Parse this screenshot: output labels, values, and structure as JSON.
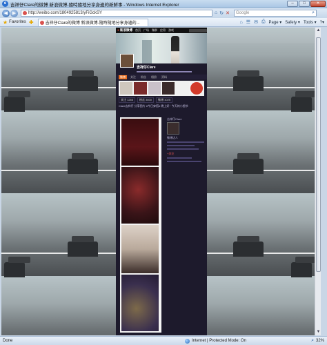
{
  "window": {
    "title": "吉祥仔Clare的微博 新浪微博-隨時隨地分享身邊的新鮮事 - Windows Internet Explorer",
    "min": "–",
    "max": "□",
    "close": "✕"
  },
  "address": {
    "url": "http://weibo.com/1804925813/yFiGckSY",
    "search_placeholder": "Google"
  },
  "commandbar": {
    "favorites_label": "Favorites",
    "tab_title": "吉祥仔Clare的微博 新浪微博-隨時隨地分享身邊的...",
    "page_label": "Page ▾",
    "safety_label": "Safety ▾",
    "tools_label": "Tools ▾",
    "help_label": "?▾"
  },
  "weibo": {
    "logo": "新浪微博",
    "nav": [
      "首页",
      "广场",
      "微群",
      "应用",
      "游戏"
    ],
    "profile_name": "吉祥仔Clare",
    "tabs": [
      "微博",
      "关注",
      "粉丝",
      "相册",
      "资料"
    ],
    "stats": [
      "关注 1266",
      "粉丝 3600",
      "微博 1025"
    ],
    "post_text": "Clare吉祥仔 分享图片 #今日穿搭# 晚上好~ 今天的小细节",
    "side_title": "吉祥仔Clare",
    "side_label": "微博达人",
    "side_red": "+关注"
  },
  "status": {
    "left": "Done",
    "zone": "Internet | Protected Mode: On",
    "zoom": "32%"
  }
}
